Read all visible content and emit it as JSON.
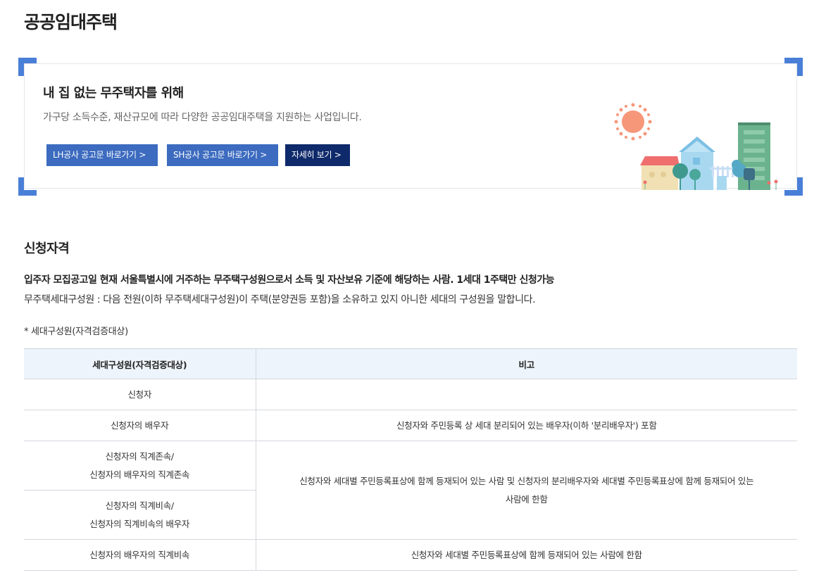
{
  "page": {
    "title": "공공임대주택"
  },
  "banner": {
    "heading": "내 집 없는 무주택자를 위해",
    "description": "가구당 소득수준, 재산규모에 따라 다양한 공공임대주택을 지원하는 사업입니다.",
    "buttons": {
      "lh": "LH공사 공고문 바로가기 >",
      "sh": "SH공사 공고문 바로가기 >",
      "more": "자세히 보기 >"
    },
    "colors": {
      "corner_accent": "#4a7fd8",
      "button_primary": "#3c6bbf",
      "button_dark": "#0f2a6b"
    }
  },
  "qualification": {
    "section_title": "신청자격",
    "main_text": "입주자 모집공고일 현재 서울특별시에 거주하는 무주택구성원으로서 소득 및 자산보유 기준에 해당하는 사람. 1세대 1주택만 신청가능",
    "sub_text": "무주택세대구성원 : 다음 전원(이하 무주택세대구성원)이 주택(분양권등 포함)을 소유하고 있지 아니한 세대의 구성원을 말합니다.",
    "table_note": "* 세대구성원(자격검증대상)"
  },
  "table": {
    "headers": [
      "세대구성원(자격검증대상)",
      "비고"
    ],
    "rows": [
      {
        "member": "신청자",
        "note": ""
      },
      {
        "member": "신청자의 배우자",
        "note": "신청자와 주민등록 상 세대 분리되어 있는 배우자(이하 '분리배우자') 포함"
      },
      {
        "member_line1": "신청자의 직계존속/",
        "member_line2": "신청자의 배우자의 직계존속",
        "note_line1": "신청자와 세대별 주민등록표상에 함께 등재되어 있는 사람 및 신청자의 분리배우자와 세대별 주민등록표상에 함께 등재되어 있는",
        "note_line2": "사람에 한함"
      },
      {
        "member_line1": "신청자의 직계비속/",
        "member_line2": "신청자의 직계비속의 배우자"
      },
      {
        "member": "신청자의 배우자의 직계비속",
        "note": "신청자와 세대별 주민등록표상에 함께 등재되어 있는 사람에 한함"
      }
    ],
    "header_bg": "#eef4fb"
  }
}
